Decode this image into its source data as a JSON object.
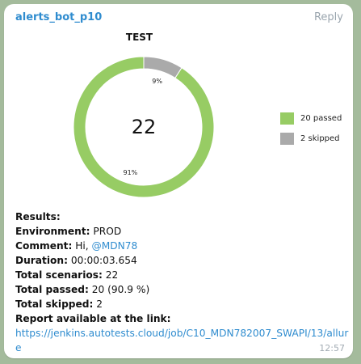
{
  "message": {
    "sender": "alerts_bot_p10",
    "reply_label": "Reply",
    "time": "12:57"
  },
  "chart_data": {
    "type": "pie",
    "title": "TEST",
    "center_label": "22",
    "slices": [
      {
        "label": "20 passed",
        "value": 20,
        "percent_label": "91%",
        "color": "#97cc64"
      },
      {
        "label": "2 skipped",
        "value": 2,
        "percent_label": "9%",
        "color": "#aaaaaa"
      }
    ],
    "donut": true,
    "legend_position": "right"
  },
  "results": {
    "heading": "Results:",
    "environment_label": "Environment:",
    "environment_value": "PROD",
    "comment_label": "Comment:",
    "comment_value": "Hi,",
    "comment_mention": "@MDN78",
    "duration_label": "Duration:",
    "duration_value": "00:00:03.654",
    "total_scenarios_label": "Total scenarios:",
    "total_scenarios_value": "22",
    "total_passed_label": "Total passed:",
    "total_passed_value": "20 (90.9 %)",
    "total_skipped_label": "Total skipped:",
    "total_skipped_value": "2",
    "report_label": "Report available at the link:",
    "report_url": "https://jenkins.autotests.cloud/job/C10_MDN782007_SWAPI/13/allure"
  }
}
